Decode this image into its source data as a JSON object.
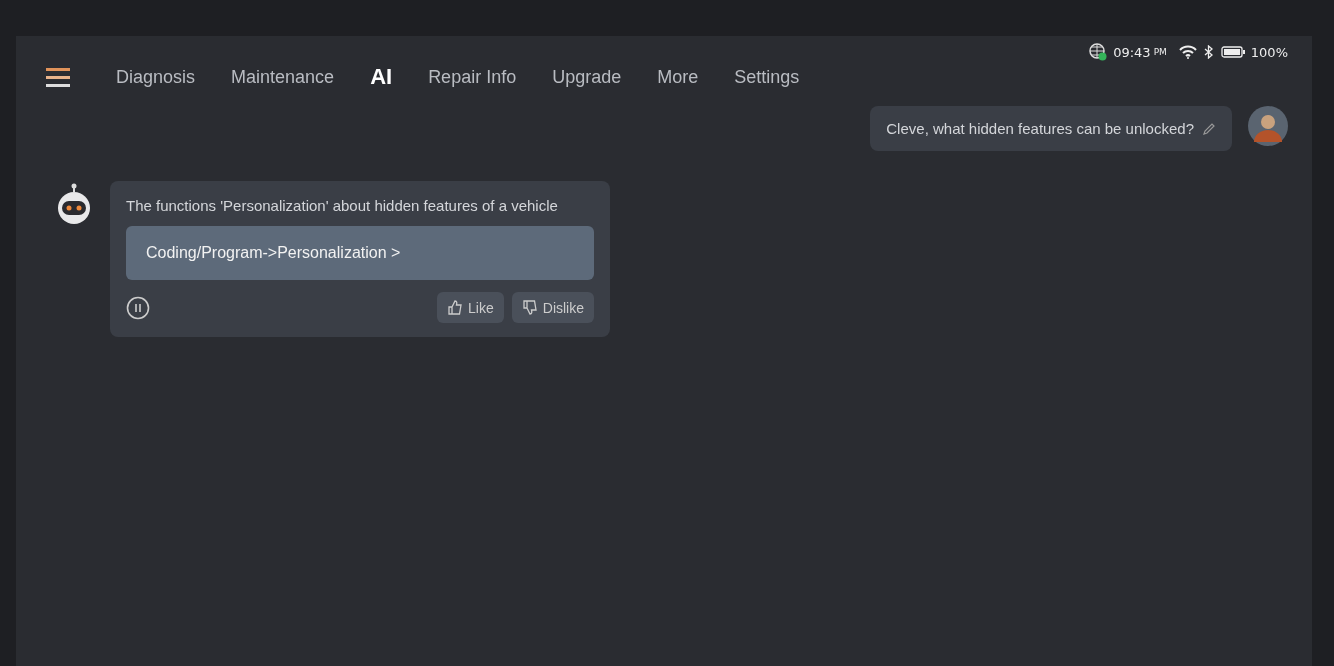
{
  "status_bar": {
    "time": "09:43",
    "meridiem": "PM",
    "battery": "100%"
  },
  "tabs": [
    {
      "label": "Diagnosis",
      "selected": false
    },
    {
      "label": "Maintenance",
      "selected": false
    },
    {
      "label": "AI",
      "selected": true
    },
    {
      "label": "Repair Info",
      "selected": false
    },
    {
      "label": "Upgrade",
      "selected": false
    },
    {
      "label": "More",
      "selected": false
    },
    {
      "label": "Settings",
      "selected": false
    }
  ],
  "chat": [
    {
      "kind": "user",
      "text": "Cleve, what hidden features can be unlocked?"
    },
    {
      "kind": "bot",
      "text": "The functions 'Personalization' about hidden features of a vehicle",
      "link": "Coding/Program->Personalization >",
      "buttons": [
        "Like",
        "Dislike"
      ]
    }
  ]
}
